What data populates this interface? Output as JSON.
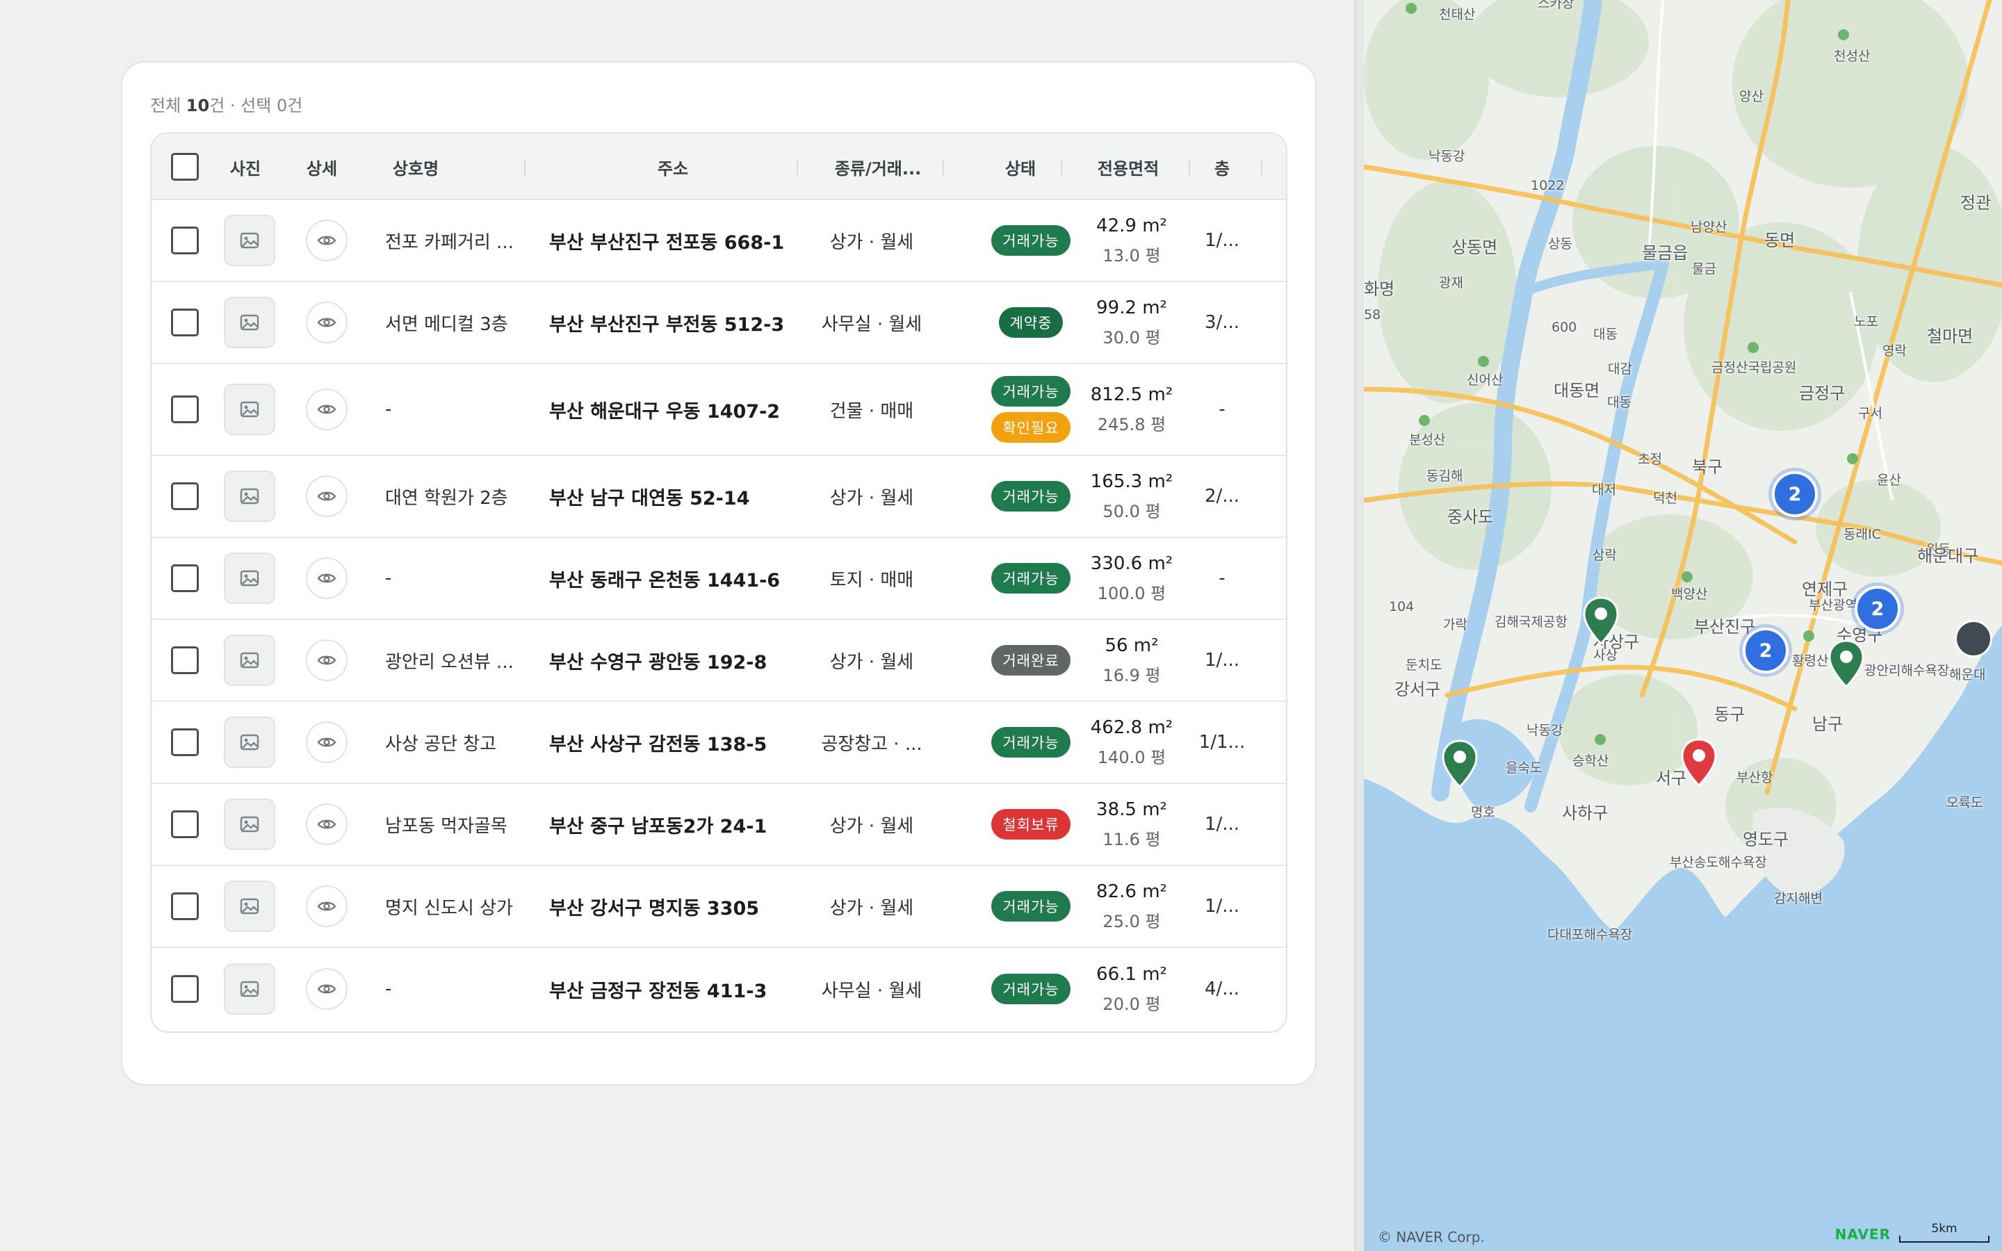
{
  "summary": {
    "total_prefix": "전체 ",
    "total_count": "10",
    "total_suffix": "건 · 선택 0건"
  },
  "table": {
    "headers": {
      "photo": "사진",
      "detail": "상세",
      "name": "상호명",
      "address": "주소",
      "kind": "종류/거래...",
      "status": "상태",
      "area": "전용면적",
      "floor": "층"
    },
    "rows": [
      {
        "name": "전포 카페거리 ...",
        "address": "부산 부산진구 전포동 668-1",
        "kind": "상가 · 월세",
        "badges": [
          {
            "label": "거래가능",
            "tone": "green"
          }
        ],
        "area_m2": "42.9 m²",
        "area_py": "13.0 평",
        "floor": "1/..."
      },
      {
        "name": "서면 메디컬 3층",
        "address": "부산 부산진구 부전동 512-3",
        "kind": "사무실 · 월세",
        "badges": [
          {
            "label": "계약중",
            "tone": "teal"
          }
        ],
        "area_m2": "99.2 m²",
        "area_py": "30.0 평",
        "floor": "3/..."
      },
      {
        "name": "-",
        "address": "부산 해운대구 우동 1407-2",
        "kind": "건물 · 매매",
        "badges": [
          {
            "label": "거래가능",
            "tone": "green"
          },
          {
            "label": "확인필요",
            "tone": "yellow"
          }
        ],
        "area_m2": "812.5 m²",
        "area_py": "245.8 평",
        "floor": "-"
      },
      {
        "name": "대연 학원가 2층",
        "address": "부산 남구 대연동 52-14",
        "kind": "상가 · 월세",
        "badges": [
          {
            "label": "거래가능",
            "tone": "green"
          }
        ],
        "area_m2": "165.3 m²",
        "area_py": "50.0 평",
        "floor": "2/..."
      },
      {
        "name": "-",
        "address": "부산 동래구 온천동 1441-6",
        "kind": "토지 · 매매",
        "badges": [
          {
            "label": "거래가능",
            "tone": "green"
          }
        ],
        "area_m2": "330.6 m²",
        "area_py": "100.0 평",
        "floor": "-"
      },
      {
        "name": "광안리 오션뷰 ...",
        "address": "부산 수영구 광안동 192-8",
        "kind": "상가 · 월세",
        "badges": [
          {
            "label": "거래완료",
            "tone": "grey"
          }
        ],
        "area_m2": "56 m²",
        "area_py": "16.9 평",
        "floor": "1/..."
      },
      {
        "name": "사상 공단 창고",
        "address": "부산 사상구 감전동 138-5",
        "kind": "공장창고 · ...",
        "badges": [
          {
            "label": "거래가능",
            "tone": "green"
          }
        ],
        "area_m2": "462.8 m²",
        "area_py": "140.0 평",
        "floor": "1/1..."
      },
      {
        "name": "남포동 먹자골목",
        "address": "부산 중구 남포동2가 24-1",
        "kind": "상가 · 월세",
        "badges": [
          {
            "label": "철회보류",
            "tone": "red"
          }
        ],
        "area_m2": "38.5 m²",
        "area_py": "11.6 평",
        "floor": "1/..."
      },
      {
        "name": "명지 신도시 상가",
        "address": "부산 강서구 명지동 3305",
        "kind": "상가 · 월세",
        "badges": [
          {
            "label": "거래가능",
            "tone": "green"
          }
        ],
        "area_m2": "82.6 m²",
        "area_py": "25.0 평",
        "floor": "1/..."
      },
      {
        "name": "-",
        "address": "부산 금정구 장전동 411-3",
        "kind": "사무실 · 월세",
        "badges": [
          {
            "label": "거래가능",
            "tone": "green"
          }
        ],
        "area_m2": "66.1 m²",
        "area_py": "20.0 평",
        "floor": "4/..."
      }
    ]
  },
  "colors": {
    "green": "#1f7a4d",
    "teal": "#186d45",
    "yellow": "#f2a20f",
    "grey": "#5f6664",
    "red": "#db3535",
    "cluster": "#2f6fe0",
    "marker_green": "#2e7d4f",
    "marker_red": "#e0393e",
    "water": "#a8d0ee"
  },
  "map": {
    "labels": [
      "천태산",
      "스카장",
      "천성산",
      "양산",
      "낙동강",
      "1022",
      "남양산",
      "동면",
      "정관",
      "상동면",
      "상동",
      "물금읍",
      "물금",
      "화명",
      "광재",
      "58",
      "600",
      "대동",
      "노포",
      "영락",
      "철마면",
      "신어산",
      "대감",
      "금정산국립공원",
      "대동면",
      "대동",
      "금정구",
      "구서",
      "분성산",
      "초정",
      "북구",
      "윤산",
      "동김해",
      "대저",
      "덕천",
      "중사도",
      "동래IC",
      "원동",
      "해운대구",
      "삼락",
      "연제구",
      "부산광역시청",
      "백양산",
      "104",
      "가락",
      "김해국제공항",
      "사상구",
      "부산진구",
      "수영구",
      "사상",
      "둔치도",
      "강서구",
      "황령산",
      "광안리해수욕장",
      "해운대",
      "동구",
      "남구",
      "낙동강",
      "을숙도",
      "승학산",
      "서구",
      "부산항",
      "명호",
      "사하구",
      "오륙도",
      "영도구",
      "부산송도해수욕장",
      "감지해변",
      "다대포해수욕장"
    ],
    "clusters": [
      "2",
      "2",
      "2"
    ],
    "copyright": "© NAVER Corp.",
    "brand": "NAVER",
    "scale": "5km"
  }
}
